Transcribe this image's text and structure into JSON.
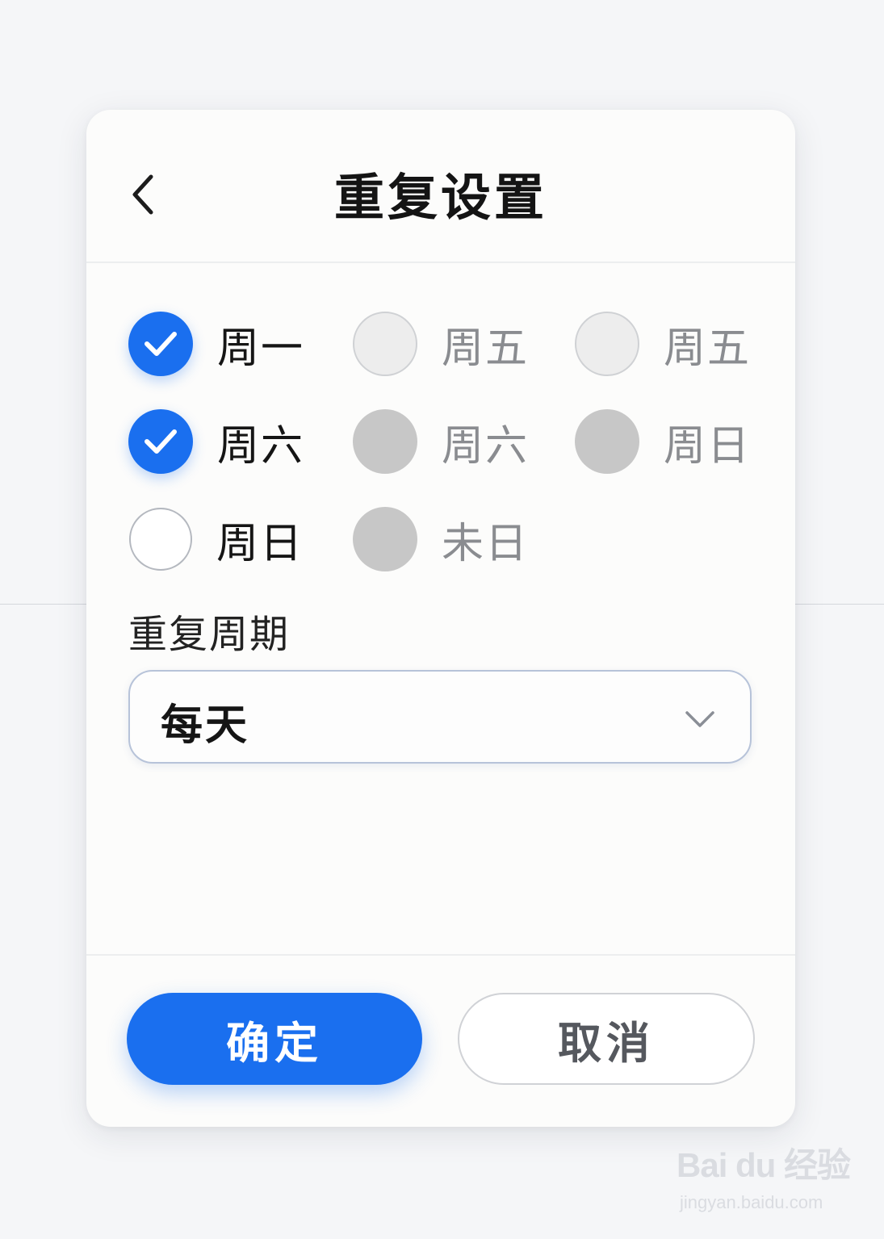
{
  "dialog": {
    "title": "重复设置",
    "back_icon": "chevron-left-icon"
  },
  "days": [
    {
      "label": "周一",
      "state": "checked"
    },
    {
      "label": "周五",
      "state": "unchecked-light"
    },
    {
      "label": "周五",
      "state": "unchecked-light"
    },
    {
      "label": "周六",
      "state": "checked"
    },
    {
      "label": "周六",
      "state": "disabled"
    },
    {
      "label": "周日",
      "state": "disabled"
    },
    {
      "label": "周日",
      "state": "unchecked"
    },
    {
      "label": "未日",
      "state": "disabled"
    }
  ],
  "period": {
    "label": "重复周期",
    "value": "每天",
    "icon": "chevron-down-icon"
  },
  "buttons": {
    "confirm": "确定",
    "cancel": "取消"
  },
  "watermark": {
    "brand": "Bai du 经验",
    "url": "jingyan.baidu.com"
  },
  "colors": {
    "accent": "#1a6fef",
    "disabled": "#c7c7c7",
    "muted_text": "#8a8c90"
  }
}
